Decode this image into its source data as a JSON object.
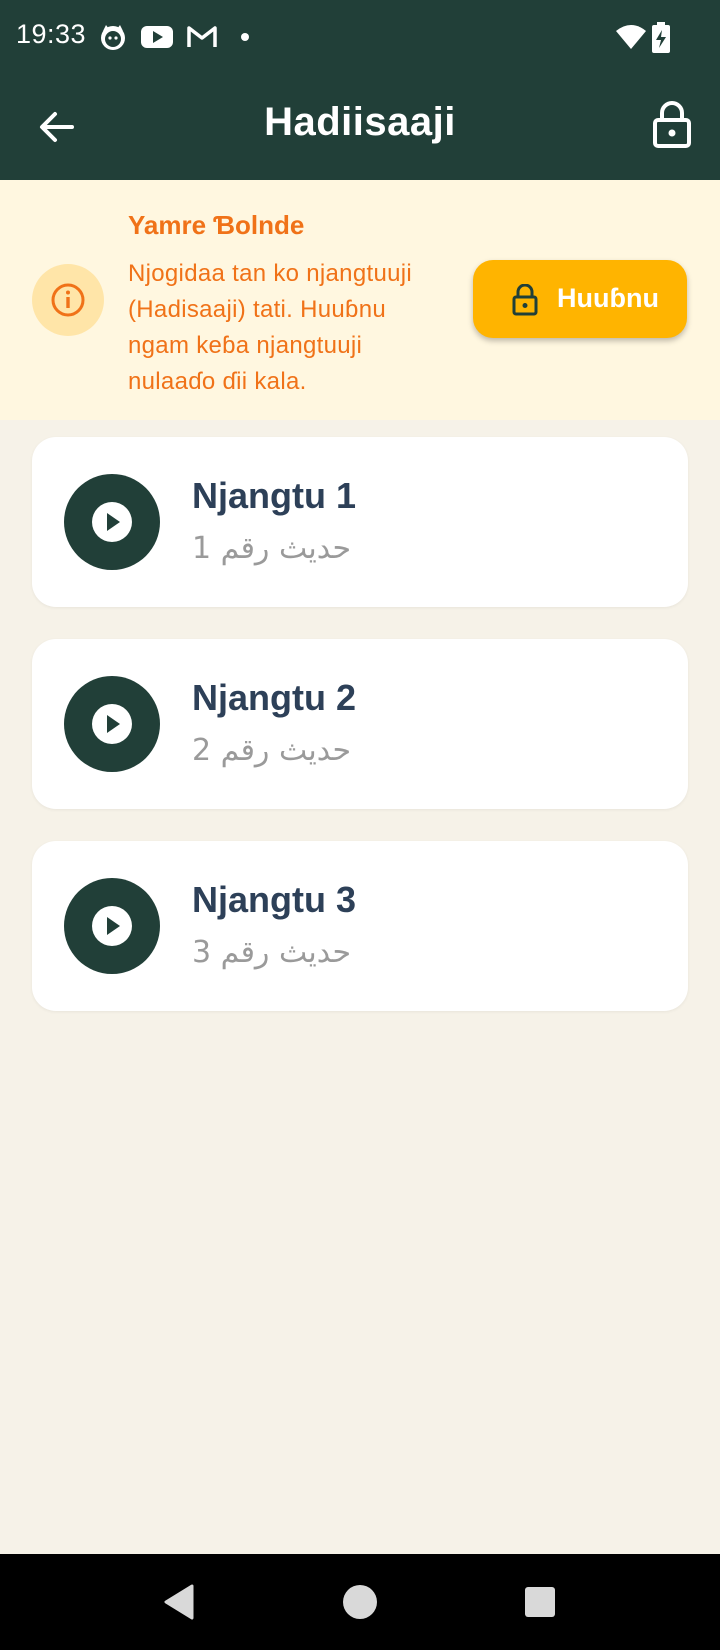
{
  "status_bar": {
    "time": "19:33",
    "left_icons": [
      "cat-app-icon",
      "youtube-icon",
      "gmail-icon",
      "dot-icon"
    ],
    "right_icons": [
      "wifi-icon",
      "battery-charging-icon"
    ]
  },
  "app_bar": {
    "title": "Hadiisaaji",
    "back_icon": "arrow-left-icon",
    "lock_icon": "lock-icon"
  },
  "banner": {
    "title": "Yamre Ɓolnde",
    "text": "Njogidaa tan ko njangtuuji (Hadisaaji) tati. Huuɓnu ngam keɓa njangtuuji nulaaɗo ɗii kala.",
    "button_label": "Huuɓnu",
    "icon": "info-icon"
  },
  "items": [
    {
      "title": "Njangtu 1",
      "subtitle": "حديث رقم 1"
    },
    {
      "title": "Njangtu 2",
      "subtitle": "حديث رقم 2"
    },
    {
      "title": "Njangtu 3",
      "subtitle": "حديث رقم 3"
    }
  ],
  "colors": {
    "primary_dark": "#213F38",
    "background": "#F6F2E8",
    "banner_bg": "#FFF7E0",
    "warning_text": "#F07218",
    "accent": "#FFB400",
    "card_title": "#2D4058",
    "card_subtitle": "#9A9A9A"
  },
  "nav": {
    "icons": [
      "nav-back-icon",
      "nav-home-icon",
      "nav-recents-icon"
    ]
  }
}
